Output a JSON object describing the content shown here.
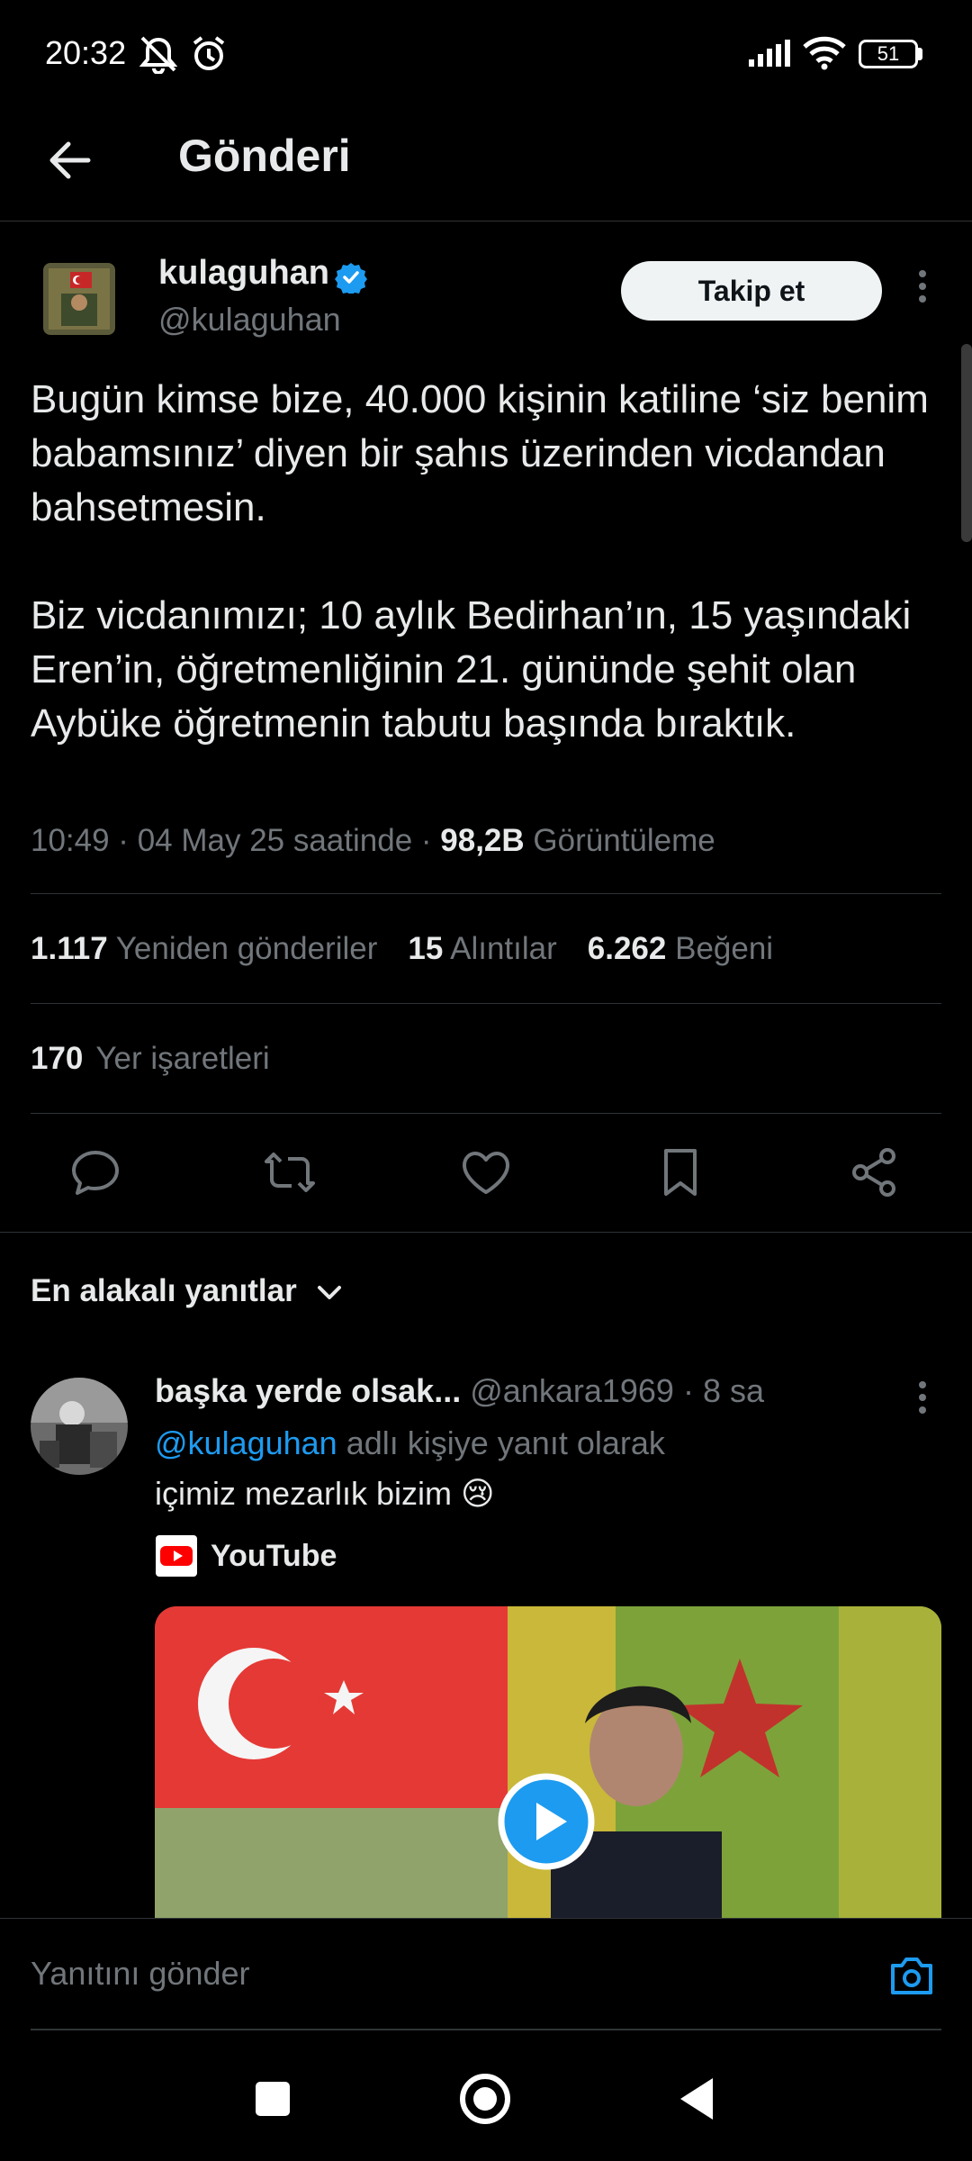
{
  "status_bar": {
    "time": "20:32",
    "battery": "51"
  },
  "header": {
    "title": "Gönderi"
  },
  "post": {
    "author_name": "kulaguhan",
    "author_handle": "@kulaguhan",
    "follow_label": "Takip et",
    "text": "Bugün kimse bize, 40.000 kişinin katiline ‘siz benim babamsınız’ diyen bir şahıs üzerinden vicdandan bahsetmesin.\n\nBiz vicdanımızı; 10 aylık Bedirhan’ın, 15 yaşındaki Eren’in, öğretmenliğinin 21. gününde şehit olan Aybüke öğretmenin tabutu başında bıraktık.",
    "timestamp": "10:49 · 04 May 25 saatinde · ",
    "views_count": "98,2B",
    "views_label": "Görüntüleme",
    "reposts_count": "1.117",
    "reposts_label": "Yeniden gönderiler",
    "quotes_count": "15",
    "quotes_label": "Alıntılar",
    "likes_count": "6.262",
    "likes_label": "Beğeni",
    "bookmarks_count": "170",
    "bookmarks_label": "Yer işaretleri"
  },
  "replies": {
    "sort_label": "En alakalı yanıtlar",
    "items": [
      {
        "author_name": "başka yerde olsak...",
        "author_handle": "@ankara1969",
        "time": " · 8 sa",
        "replying_to_handle": "@kulaguhan",
        "replying_suffix": " adlı kişiye yanıt olarak",
        "text": "içimiz mezarlık bizim 😢",
        "link_source": "YouTube"
      }
    ]
  },
  "composer": {
    "placeholder": "Yanıtını gönder"
  },
  "colors": {
    "accent": "#1d9bf0",
    "background": "#000000",
    "muted": "#71767b"
  }
}
